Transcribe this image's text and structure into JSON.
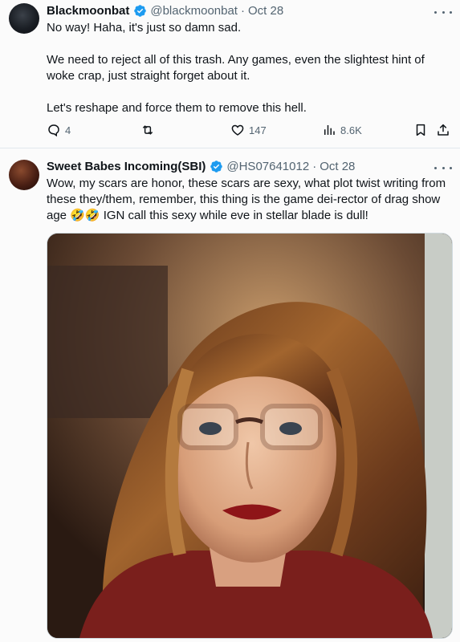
{
  "tweets": [
    {
      "display_name": "Blackmoonbat",
      "handle": "@blackmoonbat",
      "separator": "·",
      "date": "Oct 28",
      "paragraphs": [
        "No way! Haha, it's just so damn sad.",
        "We need to reject all of this trash. Any games, even the slightest hint of woke crap, just straight forget about it.",
        "Let's reshape and force them to remove this hell."
      ],
      "stats": {
        "replies": "4",
        "likes": "147",
        "views": "8.6K"
      }
    },
    {
      "display_name": "Sweet Babes Incoming(SBI)",
      "handle": "@HS07641012",
      "separator": "·",
      "date": "Oct 28",
      "text": "Wow, my scars are honor, these scars are sexy, what plot twist writing from these they/them, remember, this thing is the game dei-rector of drag show age 🤣🤣 IGN call this sexy while eve in stellar blade is dull!"
    }
  ],
  "icons": {
    "verified": "verified-badge-icon",
    "more": "more-icon",
    "reply": "reply-icon",
    "retweet": "retweet-icon",
    "like": "heart-icon",
    "views": "views-icon",
    "bookmark": "bookmark-icon",
    "share": "share-icon"
  },
  "colors": {
    "verified_blue": "#1d9bf0",
    "muted": "#536471",
    "text": "#0f1419"
  }
}
